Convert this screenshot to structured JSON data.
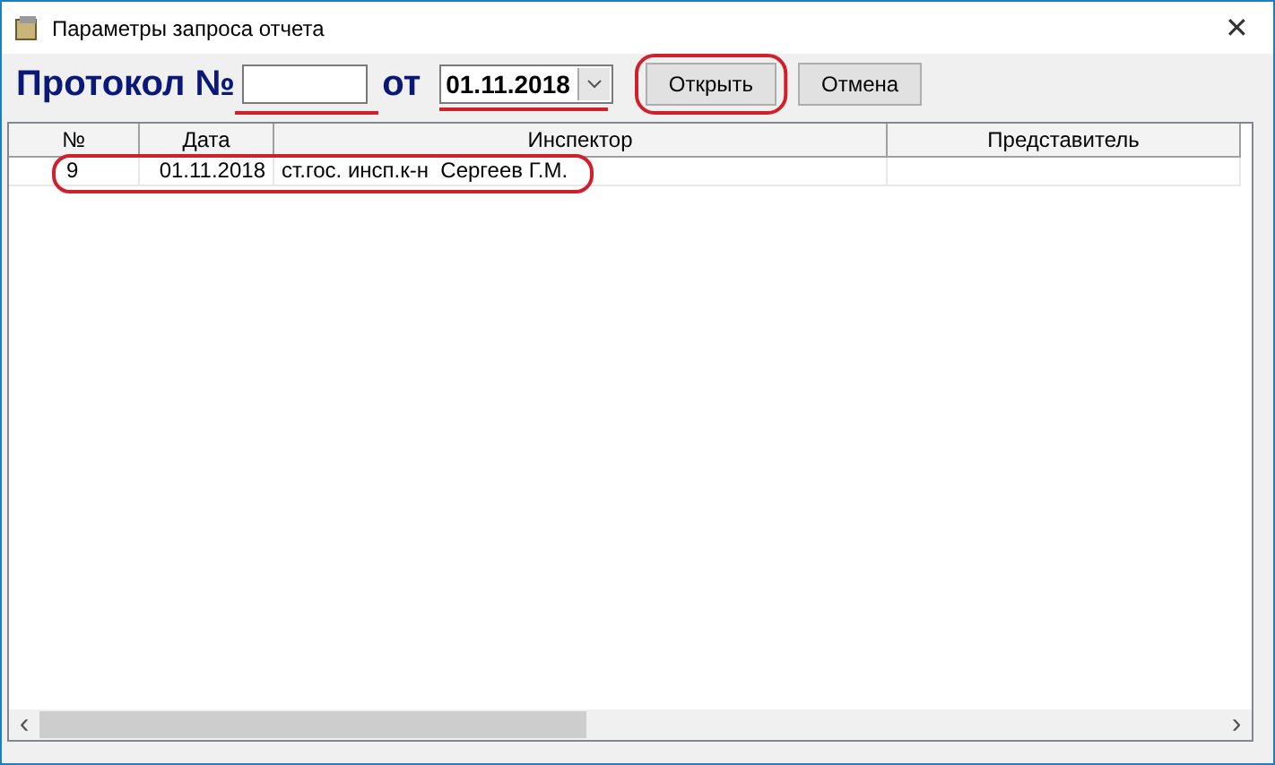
{
  "window": {
    "title": "Параметры запроса отчета",
    "close": "✕"
  },
  "form": {
    "label": "Протокол №",
    "date_label": "от",
    "date_value": "01.11.2018",
    "buttons": [
      "Открыть",
      "Отмена"
    ]
  },
  "table": {
    "columns": [
      "№",
      "Дата",
      "Инспектор",
      "Представитель"
    ],
    "rows": [
      [
        "9",
        "01.11.2018",
        "ст.гос. инсп.к-н  Сергеев Г.М.",
        ""
      ]
    ]
  },
  "scrollbar": {
    "left": "‹",
    "right": "›"
  }
}
